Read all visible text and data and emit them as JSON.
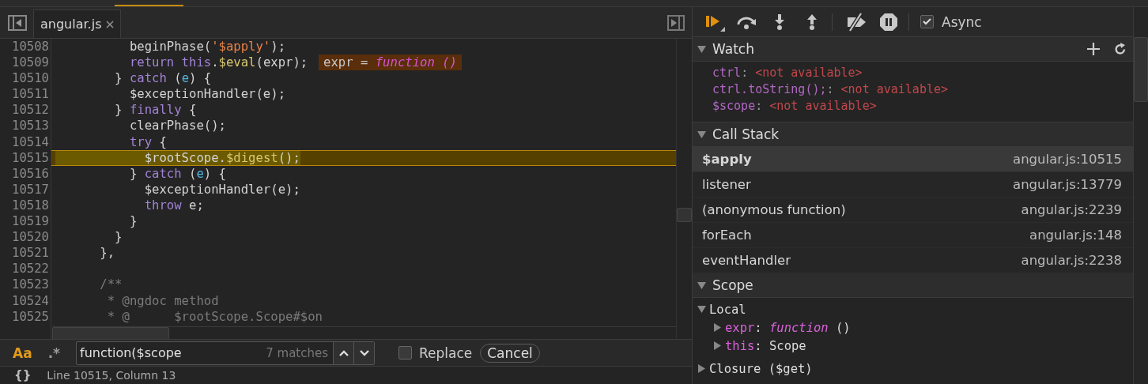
{
  "editor": {
    "tab": {
      "label": "angular.js"
    },
    "lines": [
      {
        "number": "10508",
        "current": false,
        "tokens": [
          {
            "text": "          beginPhase(",
            "kind": "plain"
          },
          {
            "text": "'$apply'",
            "kind": "string"
          },
          {
            "text": ");",
            "kind": "plain"
          }
        ]
      },
      {
        "number": "10509",
        "current": false,
        "tokens": [
          {
            "text": "          return",
            "kind": "keyword"
          },
          {
            "text": " this",
            "kind": "keyword"
          },
          {
            "text": ".",
            "kind": "plain"
          },
          {
            "text": "$eval",
            "kind": "method"
          },
          {
            "text": "(expr);",
            "kind": "plain"
          }
        ],
        "inline_value": {
          "name": "expr = ",
          "value": "function ()"
        }
      },
      {
        "number": "10510",
        "current": false,
        "tokens": [
          {
            "text": "        } ",
            "kind": "plain"
          },
          {
            "text": "catch",
            "kind": "keyword"
          },
          {
            "text": " (",
            "kind": "plain"
          },
          {
            "text": "e",
            "kind": "param"
          },
          {
            "text": ") {",
            "kind": "plain"
          }
        ]
      },
      {
        "number": "10511",
        "current": false,
        "tokens": [
          {
            "text": "          $exceptionHandler(e);",
            "kind": "plain"
          }
        ]
      },
      {
        "number": "10512",
        "current": false,
        "tokens": [
          {
            "text": "        } ",
            "kind": "plain"
          },
          {
            "text": "finally",
            "kind": "keyword"
          },
          {
            "text": " {",
            "kind": "plain"
          }
        ]
      },
      {
        "number": "10513",
        "current": false,
        "tokens": [
          {
            "text": "          clearPhase();",
            "kind": "plain"
          }
        ]
      },
      {
        "number": "10514",
        "current": false,
        "tokens": [
          {
            "text": "          try",
            "kind": "keyword"
          },
          {
            "text": " {",
            "kind": "plain"
          }
        ]
      },
      {
        "number": "10515",
        "current": true,
        "tokens": [
          {
            "text": "            $rootScope.",
            "kind": "plain"
          },
          {
            "text": "$digest",
            "kind": "method"
          },
          {
            "text": "();",
            "kind": "plain"
          }
        ]
      },
      {
        "number": "10516",
        "current": false,
        "tokens": [
          {
            "text": "          } ",
            "kind": "plain"
          },
          {
            "text": "catch",
            "kind": "keyword"
          },
          {
            "text": " (",
            "kind": "plain"
          },
          {
            "text": "e",
            "kind": "param"
          },
          {
            "text": ") {",
            "kind": "plain"
          }
        ]
      },
      {
        "number": "10517",
        "current": false,
        "tokens": [
          {
            "text": "            $exceptionHandler(e);",
            "kind": "plain"
          }
        ]
      },
      {
        "number": "10518",
        "current": false,
        "tokens": [
          {
            "text": "            throw",
            "kind": "keyword"
          },
          {
            "text": " e;",
            "kind": "plain"
          }
        ]
      },
      {
        "number": "10519",
        "current": false,
        "tokens": [
          {
            "text": "          }",
            "kind": "plain"
          }
        ]
      },
      {
        "number": "10520",
        "current": false,
        "tokens": [
          {
            "text": "        }",
            "kind": "plain"
          }
        ]
      },
      {
        "number": "10521",
        "current": false,
        "tokens": [
          {
            "text": "      },",
            "kind": "plain"
          }
        ]
      },
      {
        "number": "10522",
        "current": false
      },
      {
        "number": "10523",
        "current": false,
        "tokens": [
          {
            "text": "      /**",
            "kind": "comment"
          }
        ]
      },
      {
        "number": "10524",
        "current": false,
        "tokens": [
          {
            "text": "       * @ngdoc method",
            "kind": "comment"
          }
        ]
      },
      {
        "number": "10525",
        "current": false,
        "tokens": [
          {
            "text": "       * @",
            "kind": "comment"
          },
          {
            "text": "      $rootScope.Scope#$on",
            "kind": "comment"
          }
        ]
      }
    ]
  },
  "search": {
    "match_case": {
      "label": "Aa",
      "selected": true
    },
    "regex": {
      "label": ".*",
      "selected": false
    },
    "value": "function($scope",
    "count": "7 matches",
    "replace": {
      "label": "Replace",
      "checked": false
    },
    "cancel": "Cancel"
  },
  "status_bar": {
    "format_button": "{}",
    "position": "Line 10515, Column 13"
  },
  "debugger": {
    "toolbar": {
      "async": {
        "label": "Async",
        "checked": true
      }
    },
    "watch": {
      "title": "Watch",
      "expanded": true,
      "items": [
        {
          "name": "ctrl",
          "separator": ":",
          "value": "<not available>"
        },
        {
          "name": "ctrl.toString();",
          "separator": ":",
          "value": "<not available>"
        },
        {
          "name": "$scope",
          "separator": ":",
          "value": "<not available>"
        }
      ]
    },
    "call_stack": {
      "title": "Call Stack",
      "expanded": true,
      "frames": [
        {
          "name": "$apply",
          "location": "angular.js:10515",
          "selected": true
        },
        {
          "name": "listener",
          "location": "angular.js:13779",
          "selected": false
        },
        {
          "name": "(anonymous function)",
          "location": "angular.js:2239",
          "selected": false
        },
        {
          "name": "forEach",
          "location": "angular.js:148",
          "selected": false
        },
        {
          "name": "eventHandler",
          "location": "angular.js:2238",
          "selected": false
        }
      ]
    },
    "scope": {
      "title": "Scope",
      "expanded": true,
      "items": [
        {
          "label": "Local",
          "expanded": true,
          "children": [
            {
              "name": "expr",
              "separator": ":",
              "value": "function",
              "value_suffix": " ()",
              "kind": "function",
              "expanded": false
            },
            {
              "name": "this",
              "separator": ":",
              "value": "Scope",
              "kind": "object",
              "expanded": false
            }
          ]
        },
        {
          "label": "Closure ($get)",
          "expanded": false
        }
      ]
    }
  }
}
